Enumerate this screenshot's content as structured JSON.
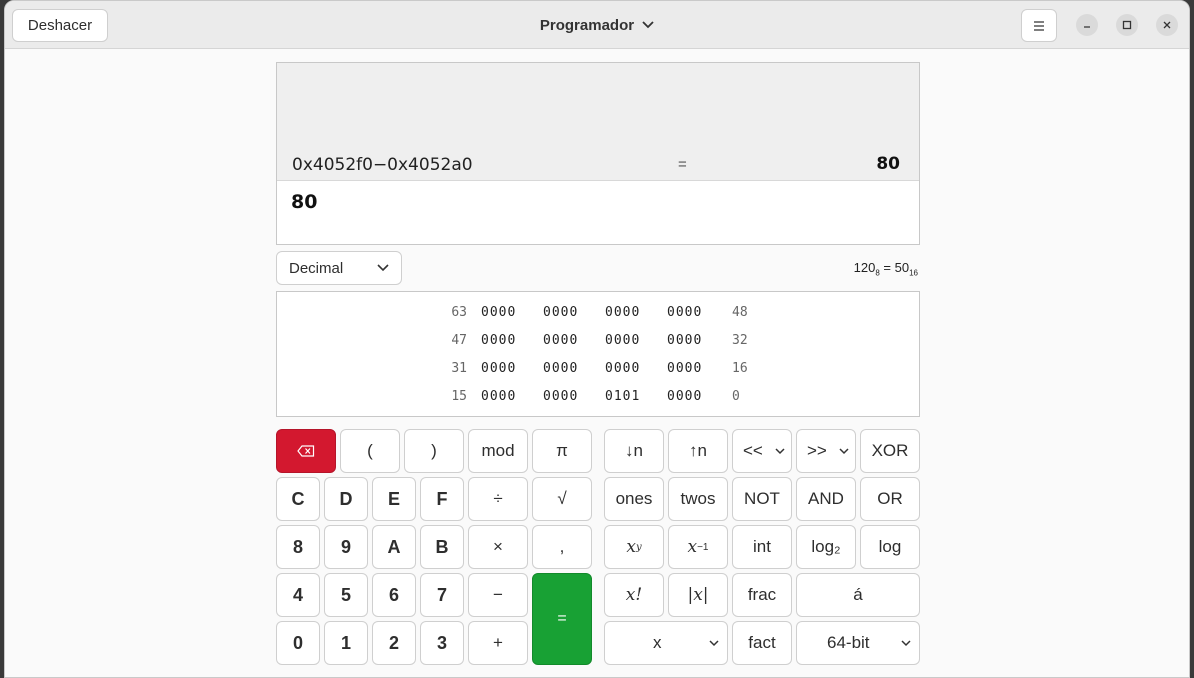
{
  "header": {
    "undo_label": "Deshacer",
    "title": "Programador",
    "menu_icon": "hamburger-icon",
    "window_controls": [
      "minimize-icon",
      "maximize-icon",
      "close-icon"
    ]
  },
  "display": {
    "history_expression": "0x4052f0−0x4052a0",
    "history_equals": "=",
    "history_result": "80",
    "current_entry": "80"
  },
  "base_select": {
    "value": "Decimal"
  },
  "conversion": {
    "octal": "120",
    "octal_base": "8",
    "equals": "=",
    "hex": "50",
    "hex_base": "16"
  },
  "bits": [
    {
      "left": "63",
      "groups": [
        "0000",
        "0000",
        "0000",
        "0000"
      ],
      "right": "48"
    },
    {
      "left": "47",
      "groups": [
        "0000",
        "0000",
        "0000",
        "0000"
      ],
      "right": "32"
    },
    {
      "left": "31",
      "groups": [
        "0000",
        "0000",
        "0000",
        "0000"
      ],
      "right": "16"
    },
    {
      "left": "15",
      "groups": [
        "0000",
        "0000",
        "0101",
        "0000"
      ],
      "right": "0"
    }
  ],
  "keys": {
    "paren_open": "(",
    "paren_close": ")",
    "mod": "mod",
    "pi": "π",
    "shift_down": "↓n",
    "shift_up": "↑n",
    "lshift": "<<",
    "rshift": ">>",
    "xor": "XOR",
    "c": "C",
    "d": "D",
    "e": "E",
    "f": "F",
    "divide": "÷",
    "sqrt": "√",
    "ones": "ones",
    "twos": "twos",
    "not": "NOT",
    "and": "AND",
    "or": "OR",
    "n8": "8",
    "n9": "9",
    "a": "A",
    "b": "B",
    "multiply": "×",
    "comma": ",",
    "xy_base": "x",
    "xy_exp": "y",
    "xinv_base": "x",
    "xinv_exp": "−1",
    "int": "int",
    "log2": "log₂",
    "log": "log",
    "n4": "4",
    "n5": "5",
    "n6": "6",
    "n7": "7",
    "minus": "−",
    "equals": "=",
    "factorial": "x!",
    "abs": "|x|",
    "frac": "frac",
    "acute": "á",
    "n0": "0",
    "n1": "1",
    "n2": "2",
    "n3": "3",
    "plus": "+",
    "x_select": "x",
    "fact": "fact",
    "word_size": "64-bit"
  }
}
